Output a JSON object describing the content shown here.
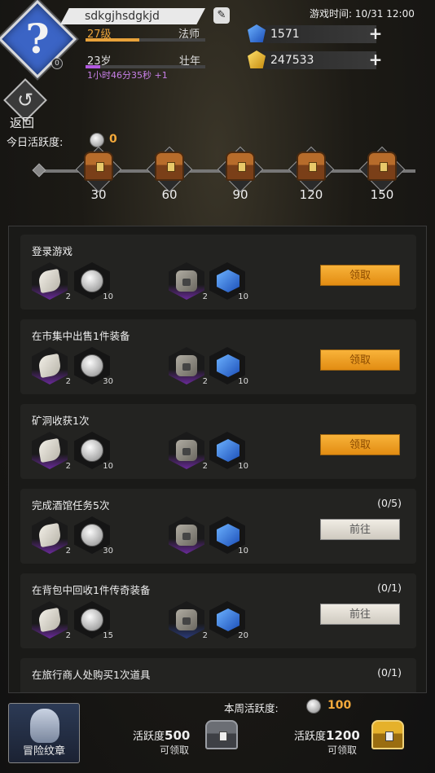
{
  "header": {
    "player_name": "sdkgjhsdgkjd",
    "level": "27级",
    "class": "法师",
    "level_progress": 0.45,
    "age": "23岁",
    "life_stage": "壮年",
    "age_progress": 0.12,
    "timer": "1小时46分35秒 +1",
    "avatar_badge": "0",
    "game_time": "游戏时间: 10/31 12:00",
    "gems": "1571",
    "gold": "247533"
  },
  "nav": {
    "back_label": "返回"
  },
  "daily": {
    "label": "今日活跃度:",
    "value": "0",
    "milestones": [
      "30",
      "60",
      "90",
      "120",
      "150"
    ]
  },
  "tasks": [
    {
      "title": "登录游戏",
      "progress": "",
      "rewards": [
        "2",
        "10",
        "2",
        "10"
      ],
      "button": "领取",
      "state": "claim"
    },
    {
      "title": "在市集中出售1件装备",
      "progress": "",
      "rewards": [
        "2",
        "30",
        "2",
        "10"
      ],
      "button": "领取",
      "state": "claim"
    },
    {
      "title": "矿洞收获1次",
      "progress": "",
      "rewards": [
        "2",
        "10",
        "2",
        "10"
      ],
      "button": "领取",
      "state": "claim"
    },
    {
      "title": "完成酒馆任务5次",
      "progress": "(0/5)",
      "rewards": [
        "2",
        "30",
        "",
        "10"
      ],
      "button": "前往",
      "state": "go"
    },
    {
      "title": "在背包中回收1件传奇装备",
      "progress": "(0/1)",
      "rewards": [
        "2",
        "15",
        "2",
        "20"
      ],
      "button": "前往",
      "state": "go"
    },
    {
      "title": "在旅行商人处购买1次道具",
      "progress": "(0/1)",
      "rewards": [],
      "button": "",
      "state": "go"
    }
  ],
  "bottom": {
    "badge_label": "冒险纹章",
    "weekly_label": "本周活跃度:",
    "weekly_value": "100",
    "chest1_prefix": "活跃度",
    "chest1_value": "500",
    "chest1_status": "可领取",
    "chest2_prefix": "活跃度",
    "chest2_value": "1200",
    "chest2_status": "可领取"
  },
  "colors": {
    "accent": "#f3a93b",
    "claim_button": "#f2a023",
    "purple": "#b25ae0"
  }
}
